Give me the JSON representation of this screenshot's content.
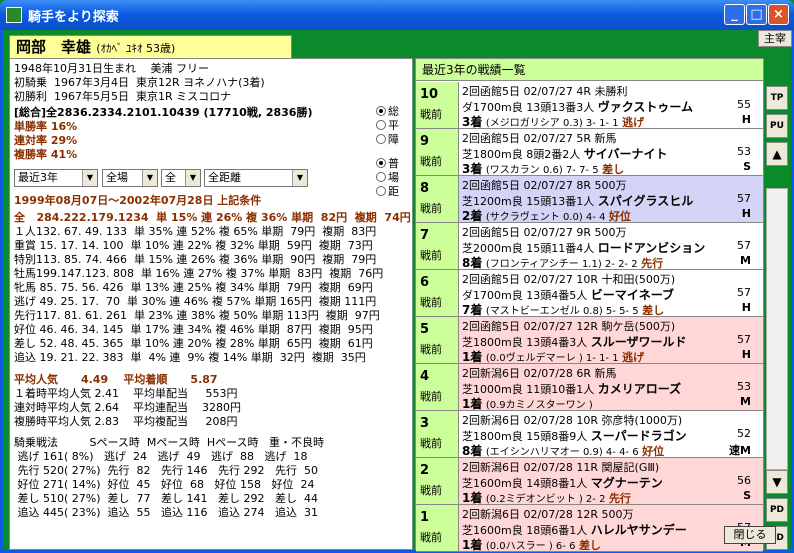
{
  "window": {
    "title": "騎手をより探索"
  },
  "jockey": {
    "name": "岡部　幸雄",
    "kana": "(ｵｶﾍﾞ ﾕｷｵ  53歳)"
  },
  "buttons": {
    "syusai": "主宰",
    "close": "閉じる",
    "tp": "TP",
    "pu": "PU",
    "pd": "PD",
    "ed": "ED"
  },
  "profile": [
    "1948年10月31日生まれ　 美浦 フリー",
    "初騎乗  1967年3月4日  東京12R ヨネノハナ(3着)",
    "初勝利  1967年5月5日  東京1R ミスコロナ"
  ],
  "summary": {
    "total": "[総合]全2836.2334.2101.10439 (17710戦, 2836勝)",
    "win": "単勝率 16%",
    "quinella": "連対率 29%",
    "place": "複勝率 41%"
  },
  "radios": {
    "group1": [
      "総",
      "平",
      "障"
    ],
    "group2": [
      "普",
      "場",
      "距"
    ]
  },
  "selects": {
    "period": "最近3年",
    "track": "全場",
    "kind": "全",
    "distance": "全距離"
  },
  "condition": "1999年08月07日～2002年07月28日 上記条件",
  "stats_rows": [
    "全   284.222.179.1234  単 15% 連 26% 複 36% 単期  82円  複期  74円",
    "１人132. 67. 49. 133  単 35% 連 52% 複 65% 単期  79円  複期  83円",
    "重賞 15. 17. 14. 100  単 10% 連 22% 複 32% 単期  59円  複期  73円",
    "特別113. 85. 74. 466  単 15% 連 26% 複 36% 単期  90円  複期  79円",
    "牡馬199.147.123. 808  単 16% 連 27% 複 37% 単期  83円  複期  76円",
    "牝馬 85. 75. 56. 426  単 13% 連 25% 複 34% 単期  79円  複期  69円",
    "逃げ 49. 25. 17.  70  単 30% 連 46% 複 57% 単期 165円  複期 111円",
    "先行117. 81. 61. 261  単 23% 連 38% 複 50% 単期 113円  複期  97円",
    "好位 46. 46. 34. 145  単 17% 連 34% 複 46% 単期  87円  複期  95円",
    "差し 52. 48. 45. 365  単 10% 連 20% 複 28% 単期  65円  複期  61円",
    "追込 19. 21. 22. 383  単  4% 連  9% 複 14% 単期  32円  複期  35円"
  ],
  "averages": {
    "l1": "平均人気      4.49    平均着順      5.87",
    "l2": "１着時平均人気 2.41    平均単配当     553円",
    "l3": "連対時平均人気 2.64    平均連配当    3280円",
    "l4": "複勝時平均人気 2.83    平均複配当     208円"
  },
  "pace_rows": [
    "騎乗戦法         Sペース時  Mペース時  Hペース時   重・不良時",
    " 逃げ 161( 8%)   逃げ  24   逃げ  49   逃げ  88   逃げ  18",
    " 先行 520( 27%)  先行  82   先行 146   先行 292   先行  50",
    " 好位 271( 14%)  好位  45   好位  68   好位 158   好位  24",
    " 差し 510( 27%)  差し  77   差し 141   差し 292   差し  44",
    " 追込 445( 23%)  追込  55   追込 116   追込 274   追込  31"
  ],
  "recent": {
    "header": "最近3年の戦績一覧",
    "races": [
      {
        "n": "10",
        "zen": "戦前",
        "l1": "2回函館5日 02/07/27  4R 未勝利",
        "l2": "ダ1700m良 13頭13番3人",
        "horse": "ヴァクストゥーム",
        "w": "55",
        "res": "3着",
        "sub": "(メジロガリシア     0.3)  3- 1- 1",
        "style": "逃げ",
        "mark": "H",
        "bg": "white"
      },
      {
        "n": "9",
        "zen": "戦前",
        "l1": "2回函館5日 02/07/27  5R 新馬",
        "l2": "芝1800m良 8頭2番2人",
        "horse": "サイバーナイト",
        "w": "53",
        "res": "3着",
        "sub": "(ワスカラン         0.6)  7- 7- 5",
        "style": "差し",
        "mark": "S",
        "bg": "white"
      },
      {
        "n": "8",
        "zen": "戦前",
        "l1": "2回函館5日 02/07/27  8R 500万",
        "l2": "芝1200m良 15頭13番1人",
        "horse": "スパイグラスヒル",
        "w": "57",
        "res": "2着",
        "sub": "(サクラヴェント     0.0)   4- 4",
        "style": "好位",
        "mark": "H",
        "bg": "lav"
      },
      {
        "n": "7",
        "zen": "戦前",
        "l1": "2回函館5日 02/07/27  9R 500万",
        "l2": "芝2000m良 15頭11番4人",
        "horse": "ロードアンビション",
        "w": "57",
        "res": "8着",
        "sub": "(フロンティアシチー  1.1)  2- 2- 2",
        "style": "先行",
        "mark": "M",
        "bg": "white"
      },
      {
        "n": "6",
        "zen": "戦前",
        "l1": "2回函館5日 02/07/27  10R 十和田(500万)",
        "l2": "ダ1700m良 13頭4番5人",
        "horse": "ビーマイネーブ",
        "w": "57",
        "res": "7着",
        "sub": "(マストビーエンゼル  0.8)  5- 5- 5",
        "style": "差し",
        "mark": "H",
        "bg": "white"
      },
      {
        "n": "5",
        "zen": "戦前",
        "l1": "2回函館5日 02/07/27  12R 駒ケ岳(500万)",
        "l2": "芝1800m良 13頭4番3人",
        "horse": "スルーザワールド",
        "w": "57",
        "res": "1着",
        "sub": "(0.0ヴェルデマーレ  )  1- 1- 1",
        "style": "逃げ",
        "mark": "H",
        "bg": "pink"
      },
      {
        "n": "4",
        "zen": "戦前",
        "l1": "2回新潟6日 02/07/28  6R 新馬",
        "l2": "芝1000m良 11頭10番1人",
        "horse": "カメリアローズ",
        "w": "53",
        "res": "1着",
        "sub": "(0.9カミノスターワン  )",
        "style": "",
        "mark": "M",
        "bg": "pink"
      },
      {
        "n": "3",
        "zen": "戦前",
        "l1": "2回新潟6日 02/07/28  10R 弥彦特(1000万)",
        "l2": "芝1800m良 15頭8番9人",
        "horse": "スーパードラゴン",
        "w": "52",
        "res": "8着",
        "sub": "(エイシンハリマオー  0.9)  4- 4- 6",
        "style": "好位",
        "mark": "速M",
        "bg": "white"
      },
      {
        "n": "2",
        "zen": "戦前",
        "l1": "2回新潟6日 02/07/28  11R 関屋記(GⅢ)",
        "l2": "芝1600m良 14頭8番1人",
        "horse": "マグナーテン",
        "w": "56",
        "res": "1着",
        "sub": "(0.2ミデオンビット  )  2- 2",
        "style": "先行",
        "mark": "S",
        "bg": "pink"
      },
      {
        "n": "1",
        "zen": "戦前",
        "l1": "2回新潟6日 02/07/28  12R 500万",
        "l2": "芝1600m良 18頭6番1人",
        "horse": "ハレルヤサンデー",
        "w": "57",
        "res": "1着",
        "sub": "(0.0ハスラー        )  6- 6",
        "style": "差し",
        "mark": "M",
        "bg": "pink"
      }
    ]
  }
}
